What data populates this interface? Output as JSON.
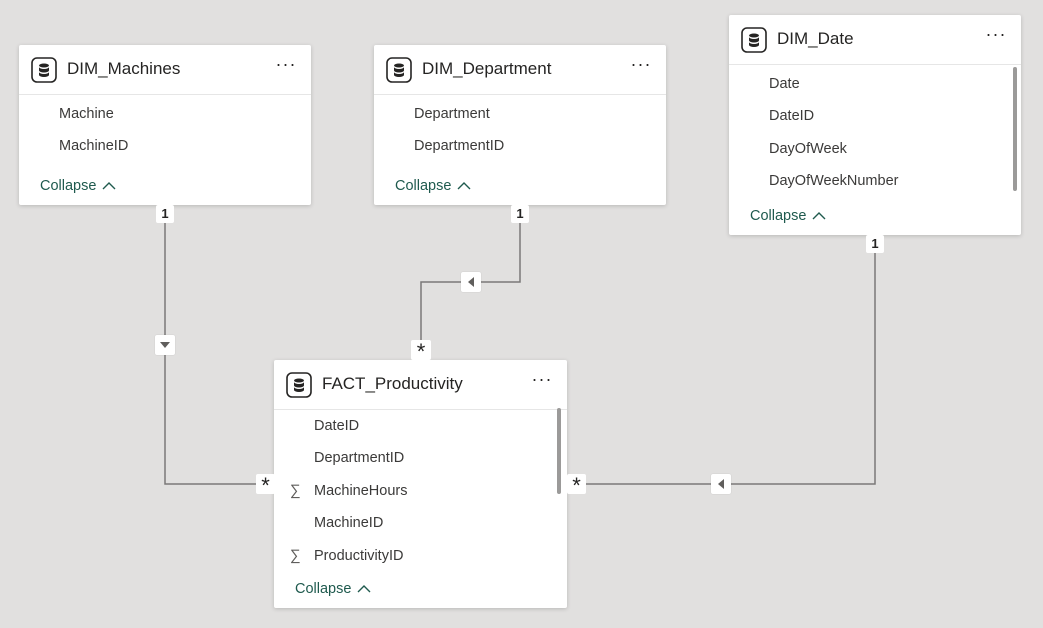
{
  "tables": {
    "dim_machines": {
      "title": "DIM_Machines",
      "fields": [
        "Machine",
        "MachineID"
      ],
      "collapse_label": "Collapse"
    },
    "dim_department": {
      "title": "DIM_Department",
      "fields": [
        "Department",
        "DepartmentID"
      ],
      "collapse_label": "Collapse"
    },
    "dim_date": {
      "title": "DIM_Date",
      "fields": [
        "Date",
        "DateID",
        "DayOfWeek",
        "DayOfWeekNumber"
      ],
      "collapse_label": "Collapse"
    },
    "fact_productivity": {
      "title": "FACT_Productivity",
      "fields": [
        "DateID",
        "DepartmentID",
        "MachineHours",
        "MachineID",
        "ProductivityID"
      ],
      "collapse_label": "Collapse"
    }
  },
  "more_label": "···",
  "sigma_symbol": "∑",
  "relationships": {
    "one_label": "1",
    "many_label": "*"
  },
  "colors": {
    "background": "#e1e0df",
    "line": "#7a7978",
    "collapse_link": "#1f5a4e"
  },
  "icons": [
    "table-icon",
    "more-options-icon",
    "chevron-up-icon",
    "sigma-icon",
    "filter-direction-arrow-icon"
  ]
}
